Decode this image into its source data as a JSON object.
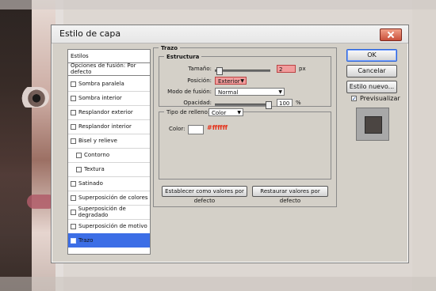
{
  "window": {
    "title": "Estilo de capa"
  },
  "left_panel": {
    "items": [
      {
        "label": "Estilos",
        "checked": null
      },
      {
        "label": "Opciones de fusión: Por defecto",
        "checked": null
      },
      {
        "label": "Sombra paralela",
        "checked": false
      },
      {
        "label": "Sombra interior",
        "checked": false
      },
      {
        "label": "Resplandor exterior",
        "checked": false
      },
      {
        "label": "Resplandor interior",
        "checked": false
      },
      {
        "label": "Bisel y relieve",
        "checked": false
      },
      {
        "label": "Contorno",
        "checked": false
      },
      {
        "label": "Textura",
        "checked": false
      },
      {
        "label": "Satinado",
        "checked": false
      },
      {
        "label": "Superposición de colores",
        "checked": false
      },
      {
        "label": "Superposición de degradado",
        "checked": false
      },
      {
        "label": "Superposición de motivo",
        "checked": false
      },
      {
        "label": "Trazo",
        "checked": true
      }
    ]
  },
  "stroke": {
    "title": "Trazo",
    "structure_title": "Estructura",
    "size_label": "Tamaño:",
    "size_value": "2",
    "size_unit": "px",
    "position_label": "Posición:",
    "position_value": "Exterior",
    "blend_label": "Modo de fusión:",
    "blend_value": "Normal",
    "opacity_label": "Opacidad:",
    "opacity_value": "100",
    "opacity_unit": "%",
    "fill_type_label": "Tipo de relleno:",
    "fill_type_value": "Color",
    "color_label": "Color:",
    "color_hex": "#ffffff"
  },
  "buttons": {
    "ok": "OK",
    "cancel": "Cancelar",
    "new_style": "Estilo nuevo...",
    "preview_label": "Previsualizar",
    "set_default": "Establecer como valores por defecto",
    "reset_default": "Restaurar valores por defecto"
  }
}
